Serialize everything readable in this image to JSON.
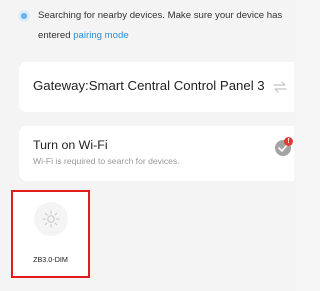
{
  "notice": {
    "icon": "radar-search-icon",
    "text": "Searching for nearby devices. Make sure your device has entered ",
    "link": "pairing mode",
    "link_color": "#2b8cd8"
  },
  "gateway": {
    "label": "Gateway:Smart Central Control Panel 3",
    "icon": "swap-icon"
  },
  "wifi": {
    "title": "Turn on Wi-Fi",
    "subtitle": "Wi-Fi is required to search for devices.",
    "icon": "gear-icon",
    "badge": "!",
    "badge_color": "#e53935"
  },
  "devices": [
    {
      "label": "ZB3.0-DIM",
      "icon": "light-bulb-icon",
      "highlight_color": "#e11c1c"
    }
  ]
}
